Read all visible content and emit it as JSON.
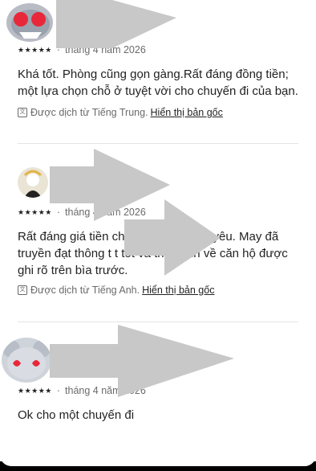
{
  "reviews": [
    {
      "avatar": "shark-emoji-avatar",
      "stars": "★★★★★",
      "date": "tháng 4 năm 2026",
      "text": "Khá tốt. Phòng cũng gọn gàng.Rất đáng đồng tiền; một lựa chọn chỗ ở tuyệt vời cho chuyến đi của bạn.",
      "translated_note": "Được dịch từ Tiếng Trung.",
      "show_original": "Hiển thị bản gốc"
    },
    {
      "avatar": "person-avatar",
      "stars": "★★★★★",
      "date": "tháng 4 năm 2026",
      "text": "Rất đáng giá tiền cho sạch sẽ, đáng yêu. May đã truyền đạt thông t t tốt và thông tin về căn hộ được ghi rõ trên bìa trước.",
      "translated_note": "Được dịch từ Tiếng Anh.",
      "show_original": "Hiển thị bản gốc"
    },
    {
      "avatar": "mouse-emoji-avatar",
      "stars": "★★★★★",
      "date": "tháng 4 năm 2026",
      "text": "Ok cho một chuyến đi"
    }
  ],
  "icons": {
    "translate": "文"
  },
  "colors": {
    "text": "#222222",
    "muted": "#6a6a6a",
    "divider": "#e4e4e4"
  }
}
